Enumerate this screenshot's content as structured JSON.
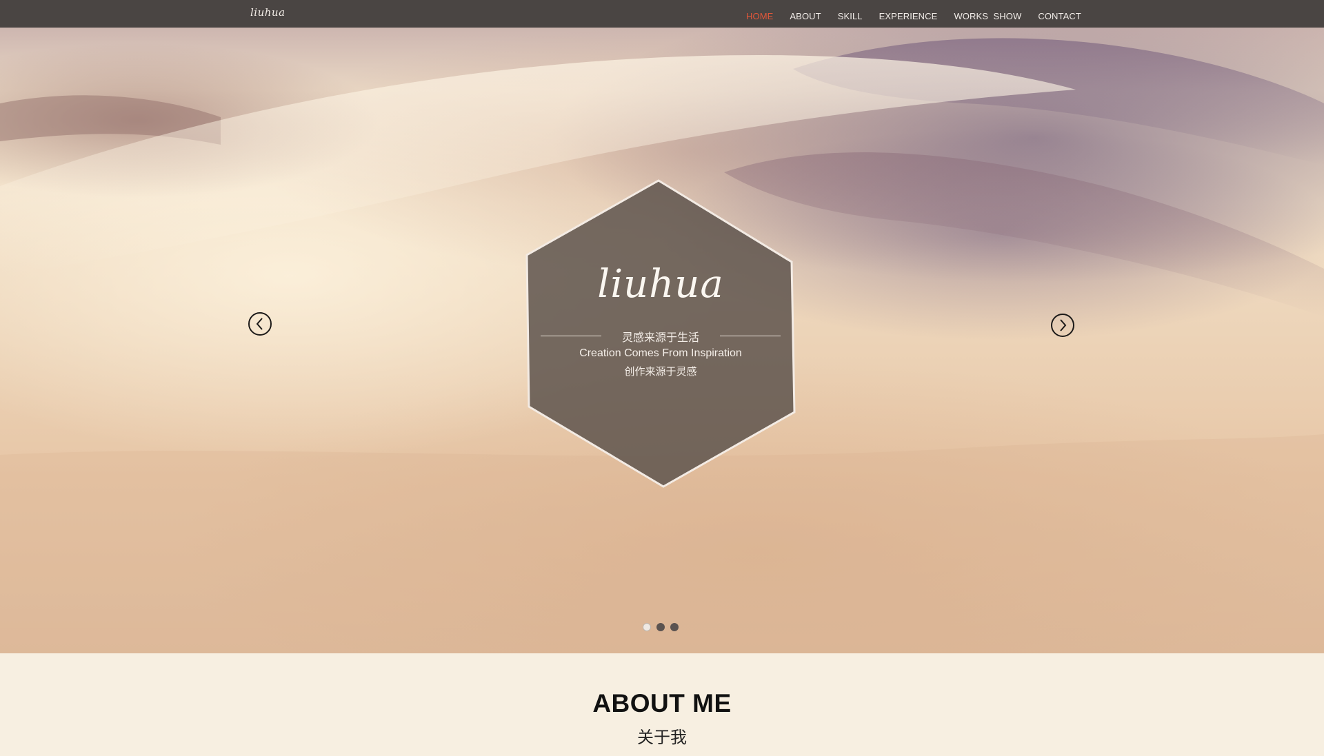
{
  "header": {
    "logo": "liuhua",
    "nav": [
      {
        "label": "HOME",
        "active": true
      },
      {
        "label": "ABOUT",
        "active": false
      },
      {
        "label": "SKILL",
        "active": false
      },
      {
        "label": "EXPERIENCE",
        "active": false
      },
      {
        "label": "WORKS  SHOW",
        "active": false
      },
      {
        "label": "CONTACT",
        "active": false
      }
    ],
    "active_color": "#e2573a"
  },
  "hero": {
    "title": "liuhua",
    "tagline": "灵感来源于生活",
    "subtitle_en": "Creation Comes From Inspiration",
    "subtitle_cn": "创作来源于灵感",
    "prev_icon": "chevron-left-icon",
    "next_icon": "chevron-right-icon",
    "slides": 3,
    "active_slide": 1
  },
  "about": {
    "title": "ABOUT ME",
    "subtitle": "关于我"
  }
}
